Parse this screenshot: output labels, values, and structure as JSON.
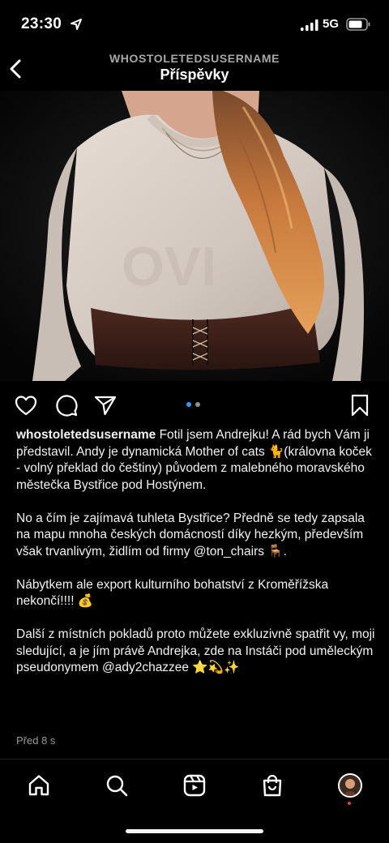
{
  "status_bar": {
    "time": "23:30",
    "network": "5G"
  },
  "header": {
    "username": "WHOSTOLETEDSUSERNAME",
    "title": "Příspěvky"
  },
  "post": {
    "carousel": {
      "total": 2,
      "active_index": 0
    },
    "caption": {
      "username": "whostoletedsusername",
      "paragraphs": [
        "Fotil jsem Andrejku! A rád bych Vám ji představil. Andy je dynamická Mother of cats 🐈(královna koček - volný překlad do češtiny) původem z malebného moravského městečka Bystřice pod Hostýnem.",
        "No a čím je zajímavá tuhleta Bystřice? Předně se tedy zapsala na mapu mnoha českých domácností díky hezkým, především však trvanlivým, židlím od firmy @ton_chairs 🪑.",
        "Nábytkem ale export kulturního bohatství z Kroměřížska nekončí!!!! 💰",
        "Další z místních pokladů proto můžete exkluzivně spatřit vy, moji sledující, a je jím právě Andrejka, zde na Instáči pod uměleckým pseudonymem @ady2chazzee ⭐💫✨"
      ]
    },
    "time_ago": "Před 8 s"
  },
  "icons": {
    "back": "chevron-left-icon",
    "like": "heart-icon",
    "comment": "comment-icon",
    "share": "paper-plane-icon",
    "save": "bookmark-icon",
    "tabs": [
      "home-icon",
      "search-icon",
      "reels-icon",
      "shop-icon",
      "profile-avatar"
    ]
  },
  "colors": {
    "background": "#000000",
    "text": "#ffffff",
    "muted": "#a8a8a8",
    "dot_active": "#3897f0",
    "dot_inactive": "#8e8e8e",
    "notification": "#ff3040"
  }
}
